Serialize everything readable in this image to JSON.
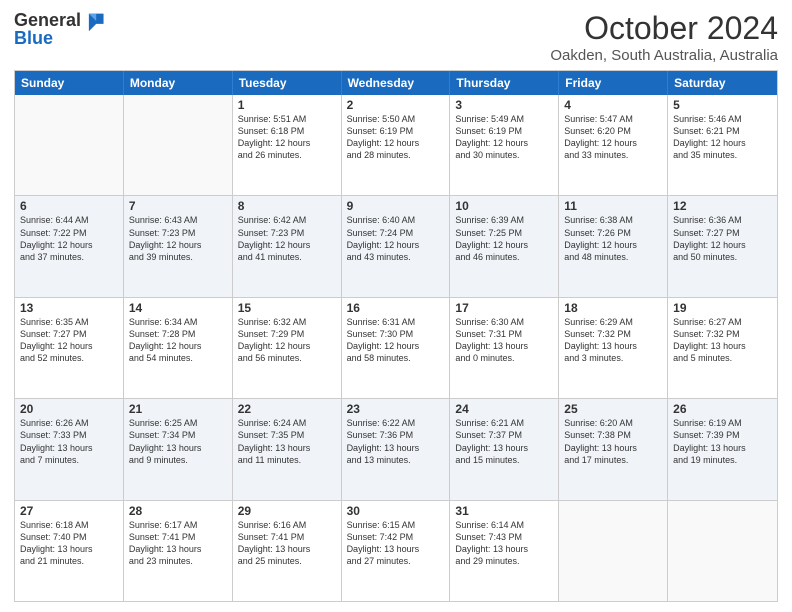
{
  "header": {
    "logo_line1": "General",
    "logo_line2": "Blue",
    "month": "October 2024",
    "location": "Oakden, South Australia, Australia"
  },
  "days_of_week": [
    "Sunday",
    "Monday",
    "Tuesday",
    "Wednesday",
    "Thursday",
    "Friday",
    "Saturday"
  ],
  "weeks": [
    {
      "alt": false,
      "days": [
        {
          "number": "",
          "text": ""
        },
        {
          "number": "",
          "text": ""
        },
        {
          "number": "1",
          "text": "Sunrise: 5:51 AM\nSunset: 6:18 PM\nDaylight: 12 hours\nand 26 minutes."
        },
        {
          "number": "2",
          "text": "Sunrise: 5:50 AM\nSunset: 6:19 PM\nDaylight: 12 hours\nand 28 minutes."
        },
        {
          "number": "3",
          "text": "Sunrise: 5:49 AM\nSunset: 6:19 PM\nDaylight: 12 hours\nand 30 minutes."
        },
        {
          "number": "4",
          "text": "Sunrise: 5:47 AM\nSunset: 6:20 PM\nDaylight: 12 hours\nand 33 minutes."
        },
        {
          "number": "5",
          "text": "Sunrise: 5:46 AM\nSunset: 6:21 PM\nDaylight: 12 hours\nand 35 minutes."
        }
      ]
    },
    {
      "alt": true,
      "days": [
        {
          "number": "6",
          "text": "Sunrise: 6:44 AM\nSunset: 7:22 PM\nDaylight: 12 hours\nand 37 minutes."
        },
        {
          "number": "7",
          "text": "Sunrise: 6:43 AM\nSunset: 7:23 PM\nDaylight: 12 hours\nand 39 minutes."
        },
        {
          "number": "8",
          "text": "Sunrise: 6:42 AM\nSunset: 7:23 PM\nDaylight: 12 hours\nand 41 minutes."
        },
        {
          "number": "9",
          "text": "Sunrise: 6:40 AM\nSunset: 7:24 PM\nDaylight: 12 hours\nand 43 minutes."
        },
        {
          "number": "10",
          "text": "Sunrise: 6:39 AM\nSunset: 7:25 PM\nDaylight: 12 hours\nand 46 minutes."
        },
        {
          "number": "11",
          "text": "Sunrise: 6:38 AM\nSunset: 7:26 PM\nDaylight: 12 hours\nand 48 minutes."
        },
        {
          "number": "12",
          "text": "Sunrise: 6:36 AM\nSunset: 7:27 PM\nDaylight: 12 hours\nand 50 minutes."
        }
      ]
    },
    {
      "alt": false,
      "days": [
        {
          "number": "13",
          "text": "Sunrise: 6:35 AM\nSunset: 7:27 PM\nDaylight: 12 hours\nand 52 minutes."
        },
        {
          "number": "14",
          "text": "Sunrise: 6:34 AM\nSunset: 7:28 PM\nDaylight: 12 hours\nand 54 minutes."
        },
        {
          "number": "15",
          "text": "Sunrise: 6:32 AM\nSunset: 7:29 PM\nDaylight: 12 hours\nand 56 minutes."
        },
        {
          "number": "16",
          "text": "Sunrise: 6:31 AM\nSunset: 7:30 PM\nDaylight: 12 hours\nand 58 minutes."
        },
        {
          "number": "17",
          "text": "Sunrise: 6:30 AM\nSunset: 7:31 PM\nDaylight: 13 hours\nand 0 minutes."
        },
        {
          "number": "18",
          "text": "Sunrise: 6:29 AM\nSunset: 7:32 PM\nDaylight: 13 hours\nand 3 minutes."
        },
        {
          "number": "19",
          "text": "Sunrise: 6:27 AM\nSunset: 7:32 PM\nDaylight: 13 hours\nand 5 minutes."
        }
      ]
    },
    {
      "alt": true,
      "days": [
        {
          "number": "20",
          "text": "Sunrise: 6:26 AM\nSunset: 7:33 PM\nDaylight: 13 hours\nand 7 minutes."
        },
        {
          "number": "21",
          "text": "Sunrise: 6:25 AM\nSunset: 7:34 PM\nDaylight: 13 hours\nand 9 minutes."
        },
        {
          "number": "22",
          "text": "Sunrise: 6:24 AM\nSunset: 7:35 PM\nDaylight: 13 hours\nand 11 minutes."
        },
        {
          "number": "23",
          "text": "Sunrise: 6:22 AM\nSunset: 7:36 PM\nDaylight: 13 hours\nand 13 minutes."
        },
        {
          "number": "24",
          "text": "Sunrise: 6:21 AM\nSunset: 7:37 PM\nDaylight: 13 hours\nand 15 minutes."
        },
        {
          "number": "25",
          "text": "Sunrise: 6:20 AM\nSunset: 7:38 PM\nDaylight: 13 hours\nand 17 minutes."
        },
        {
          "number": "26",
          "text": "Sunrise: 6:19 AM\nSunset: 7:39 PM\nDaylight: 13 hours\nand 19 minutes."
        }
      ]
    },
    {
      "alt": false,
      "days": [
        {
          "number": "27",
          "text": "Sunrise: 6:18 AM\nSunset: 7:40 PM\nDaylight: 13 hours\nand 21 minutes."
        },
        {
          "number": "28",
          "text": "Sunrise: 6:17 AM\nSunset: 7:41 PM\nDaylight: 13 hours\nand 23 minutes."
        },
        {
          "number": "29",
          "text": "Sunrise: 6:16 AM\nSunset: 7:41 PM\nDaylight: 13 hours\nand 25 minutes."
        },
        {
          "number": "30",
          "text": "Sunrise: 6:15 AM\nSunset: 7:42 PM\nDaylight: 13 hours\nand 27 minutes."
        },
        {
          "number": "31",
          "text": "Sunrise: 6:14 AM\nSunset: 7:43 PM\nDaylight: 13 hours\nand 29 minutes."
        },
        {
          "number": "",
          "text": ""
        },
        {
          "number": "",
          "text": ""
        }
      ]
    }
  ]
}
